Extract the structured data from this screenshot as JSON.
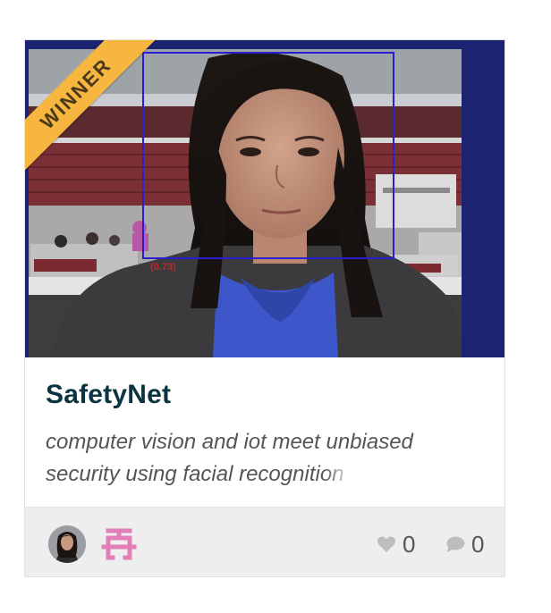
{
  "project": {
    "badge": "WINNER",
    "title": "SafetyNet",
    "tagline_main": "computer vision and iot meet unbiased security using facial recogni",
    "tagline_fade": "tion",
    "detection_score": "(0.73)"
  },
  "stats": {
    "likes": "0",
    "comments": "0"
  },
  "icons": {
    "likes": "heart-icon",
    "comments": "speech-bubble-icon",
    "team": "team-logo-icon",
    "member": "avatar"
  },
  "colors": {
    "ribbon": "#f6b63f",
    "title": "#0b3341",
    "footer": "#eeeeee",
    "team_logo": "#e37fb8",
    "thumb_border": "#1c2370"
  }
}
